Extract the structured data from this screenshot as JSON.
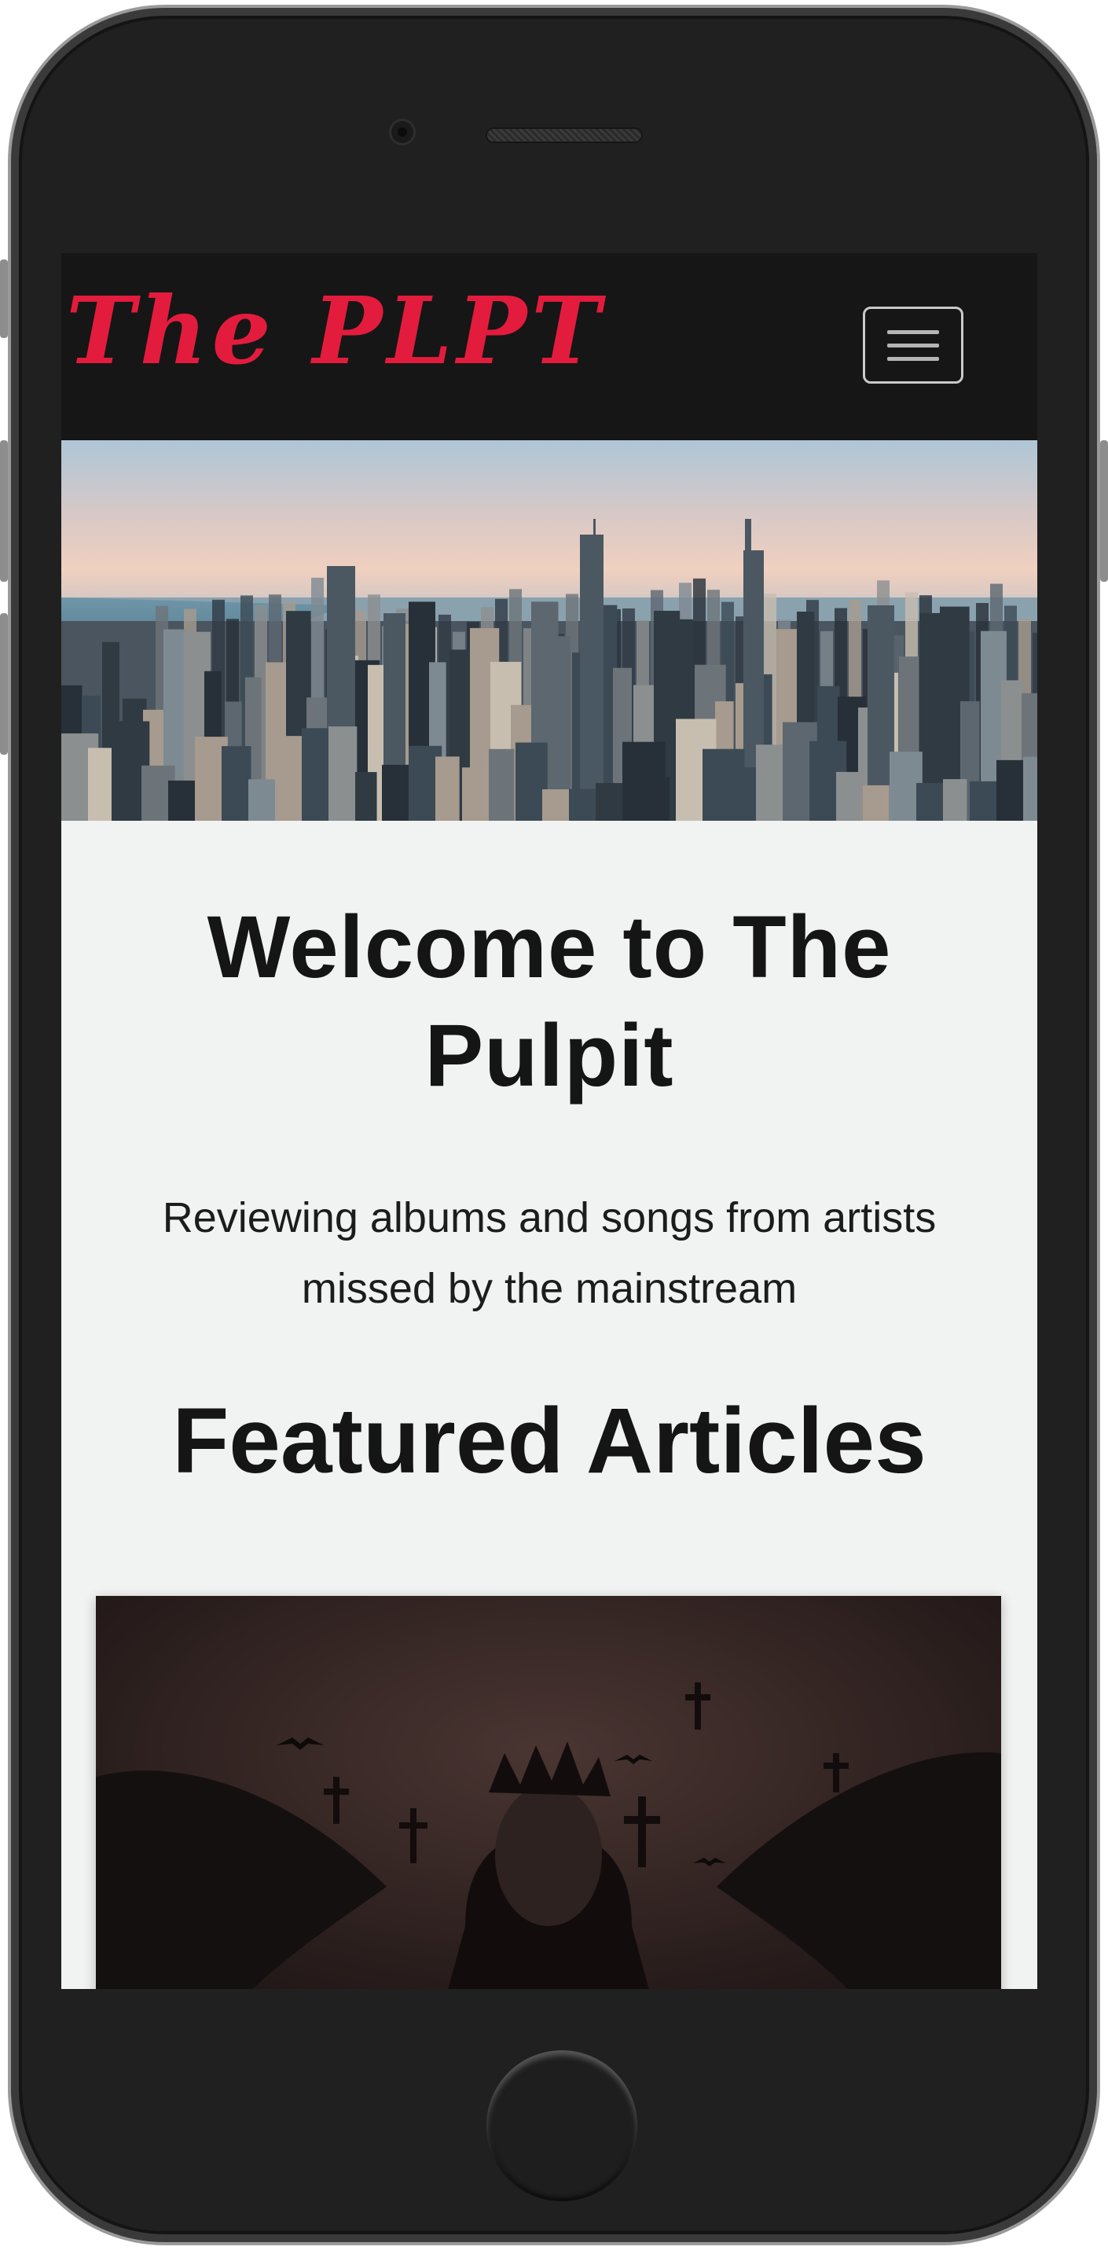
{
  "nav": {
    "brand": "The PLPT",
    "menu_icon": "hamburger-menu-icon"
  },
  "hero": {
    "image": "city-skyline-image"
  },
  "main": {
    "welcome_heading": "Welcome to The Pulpit",
    "tagline": "Reviewing albums and songs from artists missed by the mainstream",
    "featured_heading": "Featured Articles"
  },
  "featured_article": {
    "image": "album-artwork-image"
  },
  "colors": {
    "brand": "#e31c3d",
    "navbar": "#161616",
    "page_background": "#f1f2f2",
    "heading_text": "#151515"
  }
}
